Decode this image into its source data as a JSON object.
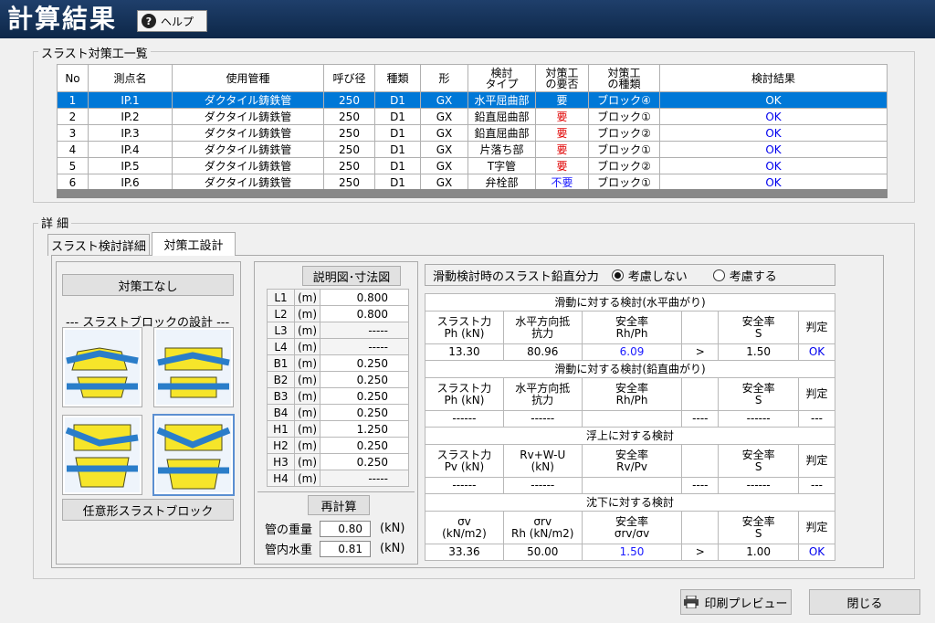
{
  "app": {
    "title": "計算結果",
    "help_label": "ヘルプ"
  },
  "list_group": {
    "label": "スラスト対策工一覧",
    "columns": [
      "No",
      "測点名",
      "使用管種",
      "呼び径",
      "種類",
      "形",
      "検討\nタイプ",
      "対策工\nの要否",
      "対策工\nの種類",
      "検討結果"
    ],
    "rows": [
      [
        "1",
        "IP.1",
        "ダクタイル鋳鉄管",
        "250",
        "D1",
        "GX",
        "水平屈曲部",
        "要",
        "ブロック④",
        "OK"
      ],
      [
        "2",
        "IP.2",
        "ダクタイル鋳鉄管",
        "250",
        "D1",
        "GX",
        "鉛直屈曲部",
        "要",
        "ブロック①",
        "OK"
      ],
      [
        "3",
        "IP.3",
        "ダクタイル鋳鉄管",
        "250",
        "D1",
        "GX",
        "鉛直屈曲部",
        "要",
        "ブロック②",
        "OK"
      ],
      [
        "4",
        "IP.4",
        "ダクタイル鋳鉄管",
        "250",
        "D1",
        "GX",
        "片落ち部",
        "要",
        "ブロック①",
        "OK"
      ],
      [
        "5",
        "IP.5",
        "ダクタイル鋳鉄管",
        "250",
        "D1",
        "GX",
        "T字管",
        "要",
        "ブロック②",
        "OK"
      ],
      [
        "6",
        "IP.6",
        "ダクタイル鋳鉄管",
        "250",
        "D1",
        "GX",
        "弁栓部",
        "不要",
        "ブロック①",
        "OK"
      ]
    ],
    "selected_row": 0
  },
  "detail_group": {
    "label": "詳 細",
    "tabs": [
      "スラスト検討詳細",
      "対策工設計"
    ],
    "active_tab": 1
  },
  "left_panel": {
    "no_measure_label": "対策工なし",
    "block_design_title": "--- スラストブロックの設計 ---",
    "selected_block": 3,
    "custom_block_label": "任意形スラストブロック"
  },
  "dimensions": {
    "diagram_button": "説明図･寸法図",
    "rows": [
      {
        "name": "L1",
        "unit": "(m)",
        "value": "0.800"
      },
      {
        "name": "L2",
        "unit": "(m)",
        "value": "0.800"
      },
      {
        "name": "L3",
        "unit": "(m)",
        "value": "-----"
      },
      {
        "name": "L4",
        "unit": "(m)",
        "value": "-----"
      },
      {
        "name": "B1",
        "unit": "(m)",
        "value": "0.250"
      },
      {
        "name": "B2",
        "unit": "(m)",
        "value": "0.250"
      },
      {
        "name": "B3",
        "unit": "(m)",
        "value": "0.250"
      },
      {
        "name": "B4",
        "unit": "(m)",
        "value": "0.250"
      },
      {
        "name": "H1",
        "unit": "(m)",
        "value": "1.250"
      },
      {
        "name": "H2",
        "unit": "(m)",
        "value": "0.250"
      },
      {
        "name": "H3",
        "unit": "(m)",
        "value": "0.250"
      },
      {
        "name": "H4",
        "unit": "(m)",
        "value": "-----"
      }
    ],
    "recalc_button": "再計算",
    "pipe_weight_label": "管の重量",
    "pipe_weight_value": "0.80",
    "pipe_weight_unit": "(kN)",
    "water_weight_label": "管内水重",
    "water_weight_value": "0.81",
    "water_weight_unit": "(kN)"
  },
  "vertical_component": {
    "label": "滑動検討時のスラスト鉛直分力",
    "option_no": "考慮しない",
    "option_yes": "考慮する",
    "selected": "no"
  },
  "checks": {
    "horizontal_title": "滑動に対する検討(水平曲がり)",
    "vertical_title": "滑動に対する検討(鉛直曲がり)",
    "uplift_title": "浮上に対する検討",
    "settle_title": "沈下に対する検討",
    "h_headers": [
      "スラスト力\nPh (kN)",
      "水平方向抵\n抗力",
      "安全率\nRh/Ph",
      "",
      "安全率\nS",
      "判定"
    ],
    "h_values": [
      "13.30",
      "80.96",
      "6.09",
      ">",
      "1.50",
      "OK"
    ],
    "v_headers": [
      "スラスト力\nPh (kN)",
      "水平方向抵\n抗力",
      "安全率\nRh/Ph",
      "",
      "安全率\nS",
      "判定"
    ],
    "v_values": [
      "------",
      "------",
      "",
      "----",
      "------",
      "---"
    ],
    "u_headers": [
      "スラスト力\nPv (kN)",
      "Rv+W-U\n(kN)",
      "安全率\nRv/Pv",
      "",
      "安全率\nS",
      "判定"
    ],
    "u_values": [
      "------",
      "------",
      "",
      "----",
      "------",
      "---"
    ],
    "s_headers": [
      "σv\n(kN/m2)",
      "σrv\nRh (kN/m2)",
      "安全率\nσrv/σv",
      "",
      "安全率\nS",
      "判定"
    ],
    "s_values": [
      "33.36",
      "50.00",
      "1.50",
      ">",
      "1.00",
      "OK"
    ]
  },
  "footer": {
    "print_preview": "印刷プレビュー",
    "close": "閉じる"
  },
  "colors": {
    "selection": "#0078d7",
    "required": "#e00000",
    "ok": "#0000ee",
    "titlebar": "#15325a"
  }
}
